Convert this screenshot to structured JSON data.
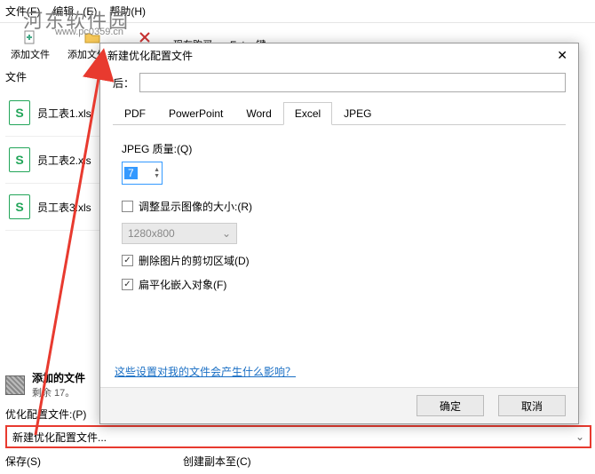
{
  "menubar": {
    "file": "文件(F)",
    "edit": "编辑...(E)",
    "help": "帮助(H)"
  },
  "toolbar": {
    "add_file": "添加文件",
    "add_folder": "添加文件夹",
    "remove": "移除",
    "buy_now": "现在购买",
    "enter_key": "Enter 键"
  },
  "watermark": {
    "text": "河东软件园",
    "url": "www.pc0359.cn"
  },
  "left": {
    "section": "文件",
    "files": [
      "员工表1.xls",
      "员工表2.xls",
      "员工表3.xls"
    ]
  },
  "modal": {
    "title": "新建优化配置文件",
    "name_label": "后：",
    "tabs": {
      "pdf": "PDF",
      "ppt": "PowerPoint",
      "word": "Word",
      "excel": "Excel",
      "jpeg": "JPEG"
    },
    "excel": {
      "quality_label": "JPEG 质量:(Q)",
      "quality_value": "7",
      "resize_label": "调整显示图像的大小:(R)",
      "resolution": "1280x800",
      "crop_label": "删除图片的剪切区域(D)",
      "flatten_label": "扁平化嵌入对象(F)"
    },
    "help_link": "这些设置对我的文件会产生什么影响？",
    "ok": "确定",
    "cancel": "取消"
  },
  "bottom": {
    "added_label": "添加的文件",
    "remaining": "剩余 17。",
    "opt_profile_label": "优化配置文件:(P)",
    "opt_profile_value": "新建优化配置文件...",
    "save_label": "保存(S)",
    "copy_label": "创建副本至(C)"
  }
}
